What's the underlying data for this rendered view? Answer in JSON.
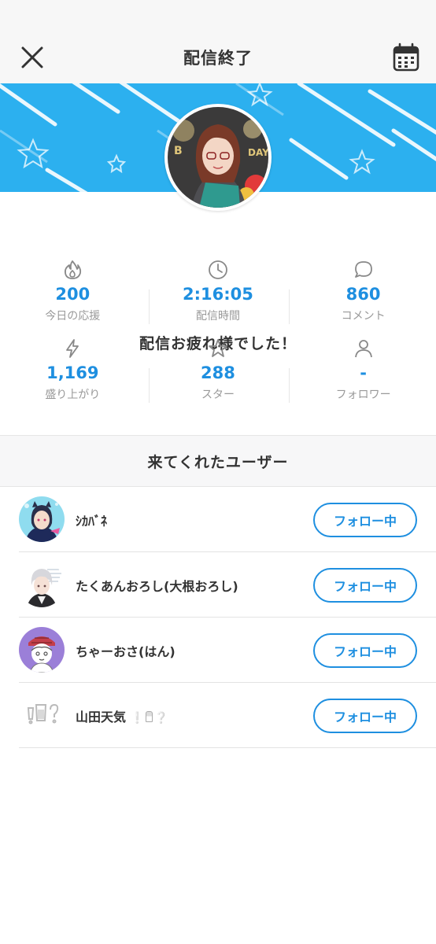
{
  "header": {
    "title": "配信終了",
    "close_icon": "close-icon",
    "calendar_icon": "calendar-icon"
  },
  "banner": {
    "colors": {
      "bg": "#2cb0ef"
    }
  },
  "thanks_message": "配信お疲れ様でした！",
  "stats": {
    "row1": [
      {
        "icon": "flame-icon",
        "value": "200",
        "label": "今日の応援"
      },
      {
        "icon": "clock-icon",
        "value": "2:16:05",
        "label": "配信時間"
      },
      {
        "icon": "comment-icon",
        "value": "860",
        "label": "コメント"
      }
    ],
    "row2": [
      {
        "icon": "lightning-icon",
        "value": "1,169",
        "label": "盛り上がり"
      },
      {
        "icon": "star-icon",
        "value": "288",
        "label": "スター"
      },
      {
        "icon": "user-icon",
        "value": "-",
        "label": "フォロワー"
      }
    ]
  },
  "visitors": {
    "heading": "来てくれたユーザー",
    "follow_label": "フォロー中",
    "users": [
      {
        "name": "ｼｶﾊﾞﾈ"
      },
      {
        "name": "たくあんおろし(大根おろし)"
      },
      {
        "name": "ちゃーおさ(はん)"
      },
      {
        "name": "山田天気"
      }
    ]
  },
  "colors": {
    "accent": "#1e8fe0",
    "text": "#333333",
    "muted": "#999999"
  }
}
